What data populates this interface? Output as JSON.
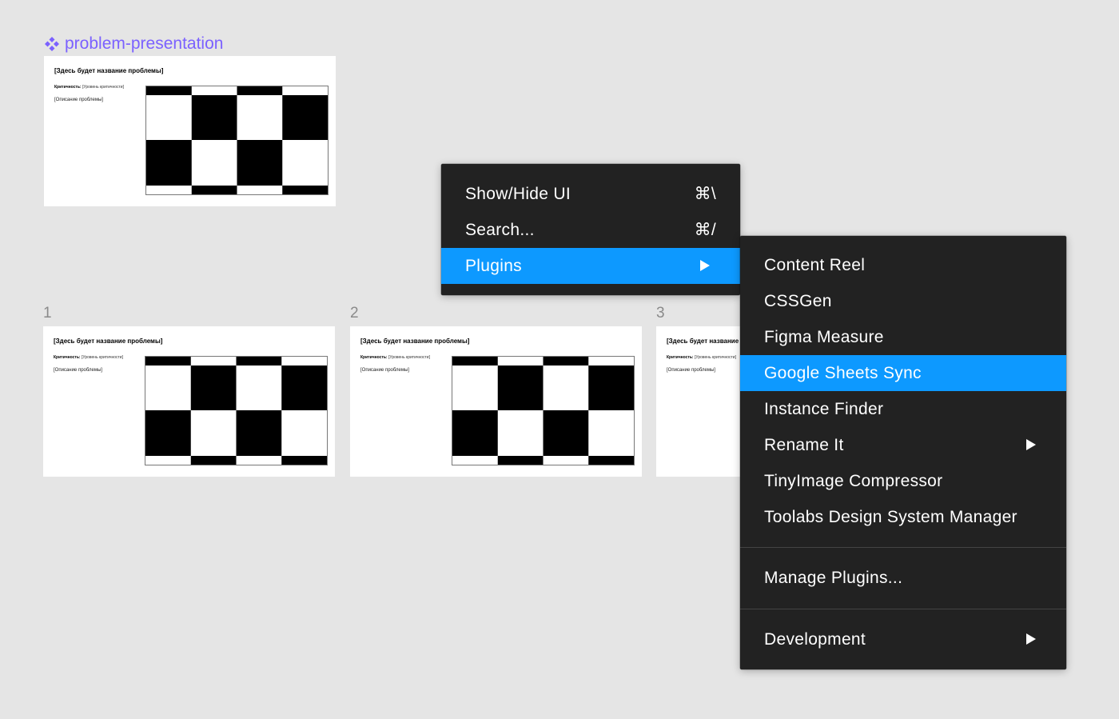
{
  "component": {
    "name": "problem-presentation",
    "icon": "component-icon",
    "color": "#7b61ff"
  },
  "slide_template": {
    "title": "[Здесь будет название проблемы]",
    "criticality_label": "Критичность:",
    "criticality_value": "[Уровень критичности]",
    "description": "[Описание проблемы]",
    "image": "checkerboard-placeholder"
  },
  "frames": [
    {
      "number": "1"
    },
    {
      "number": "2"
    },
    {
      "number": "3"
    }
  ],
  "main_menu": {
    "items": [
      {
        "label": "Show/Hide UI",
        "shortcut": "⌘\\"
      },
      {
        "label": "Search...",
        "shortcut": "⌘/"
      },
      {
        "label": "Plugins",
        "submenu": true,
        "selected": true,
        "icon": "submenu-arrow-icon"
      }
    ]
  },
  "plugins_menu": {
    "items": [
      {
        "label": "Content Reel"
      },
      {
        "label": "CSSGen"
      },
      {
        "label": "Figma Measure"
      },
      {
        "label": "Google Sheets Sync",
        "selected": true
      },
      {
        "label": "Instance Finder"
      },
      {
        "label": "Rename It",
        "submenu": true
      },
      {
        "label": "TinyImage Compressor"
      },
      {
        "label": "Toolabs Design System Manager"
      }
    ],
    "manage_label": "Manage Plugins...",
    "development_label": "Development"
  },
  "colors": {
    "canvas": "#e5e5e5",
    "menu_bg": "#222222",
    "highlight": "#0d99ff"
  }
}
